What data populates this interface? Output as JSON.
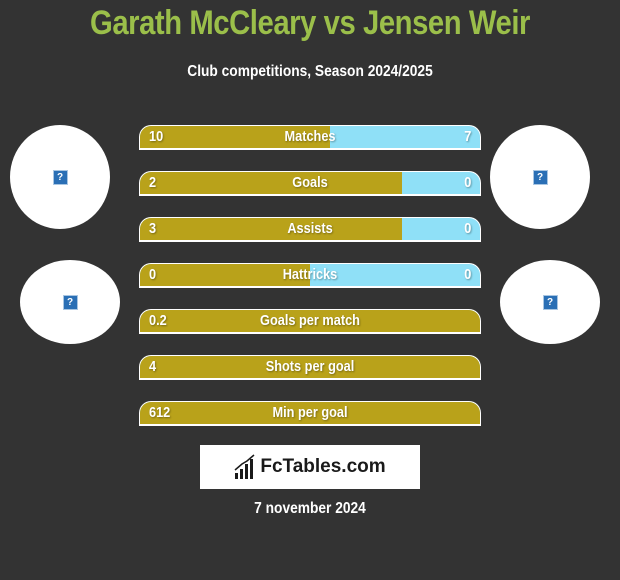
{
  "header": {
    "title": "Garath McCleary vs Jensen Weir",
    "subtitle": "Club competitions, Season 2024/2025"
  },
  "players": {
    "left": {
      "name": "Garath McCleary",
      "avatar_icon": "missing-image-icon",
      "club_icon": "missing-image-icon"
    },
    "right": {
      "name": "Jensen Weir",
      "avatar_icon": "missing-image-icon",
      "club_icon": "missing-image-icon"
    }
  },
  "colors": {
    "title": "#9bbf4a",
    "left_bar": "#b9a21a",
    "right_bar": "#8fe0f7",
    "background": "#333333"
  },
  "stats": [
    {
      "label": "Matches",
      "left": "10",
      "right": "7",
      "left_fraction": 0.56
    },
    {
      "label": "Goals",
      "left": "2",
      "right": "0",
      "left_fraction": 0.77
    },
    {
      "label": "Assists",
      "left": "3",
      "right": "0",
      "left_fraction": 0.77
    },
    {
      "label": "Hattricks",
      "left": "0",
      "right": "0",
      "left_fraction": 0.5
    },
    {
      "label": "Goals per match",
      "left": "0.2",
      "right": "",
      "left_fraction": 1
    },
    {
      "label": "Shots per goal",
      "left": "4",
      "right": "",
      "left_fraction": 1
    },
    {
      "label": "Min per goal",
      "left": "612",
      "right": "",
      "left_fraction": 1
    }
  ],
  "footer": {
    "logo_text": "FcTables.com",
    "date": "7 november 2024"
  }
}
